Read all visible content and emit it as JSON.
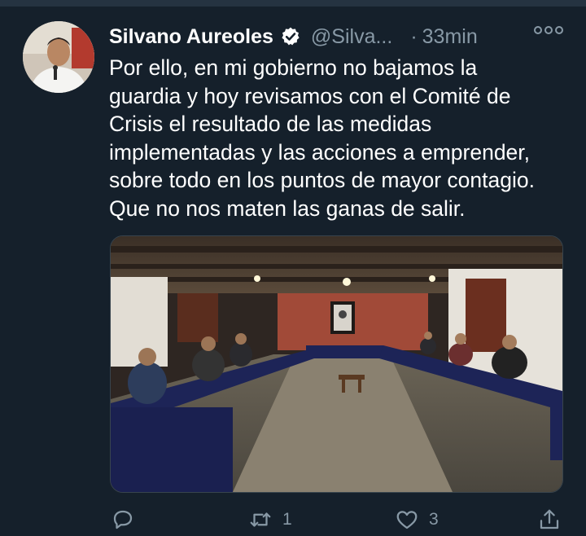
{
  "tweet": {
    "author_name": "Silvano Aureoles",
    "handle": "@Silva...",
    "separator": "·",
    "time": "33min",
    "text": "Por ello, en mi gobierno no bajamos la\nguardia y hoy revisamos con el Comité de\nCrisis el resultado de las medidas\nimplementadas y las acciones a emprender,\nsobre todo en los puntos de mayor contagio.\nQue no nos maten las ganas de salir."
  },
  "actions": {
    "reply_count": "",
    "retweet_count": "1",
    "like_count": "3"
  },
  "icons": {
    "verified": "verified-badge-icon",
    "more": "more-options-icon",
    "reply": "reply-icon",
    "retweet": "retweet-icon",
    "like": "heart-icon",
    "share": "share-icon"
  },
  "colors": {
    "background": "#15202b",
    "secondary_text": "#8899a6",
    "primary_text": "#ffffff"
  }
}
